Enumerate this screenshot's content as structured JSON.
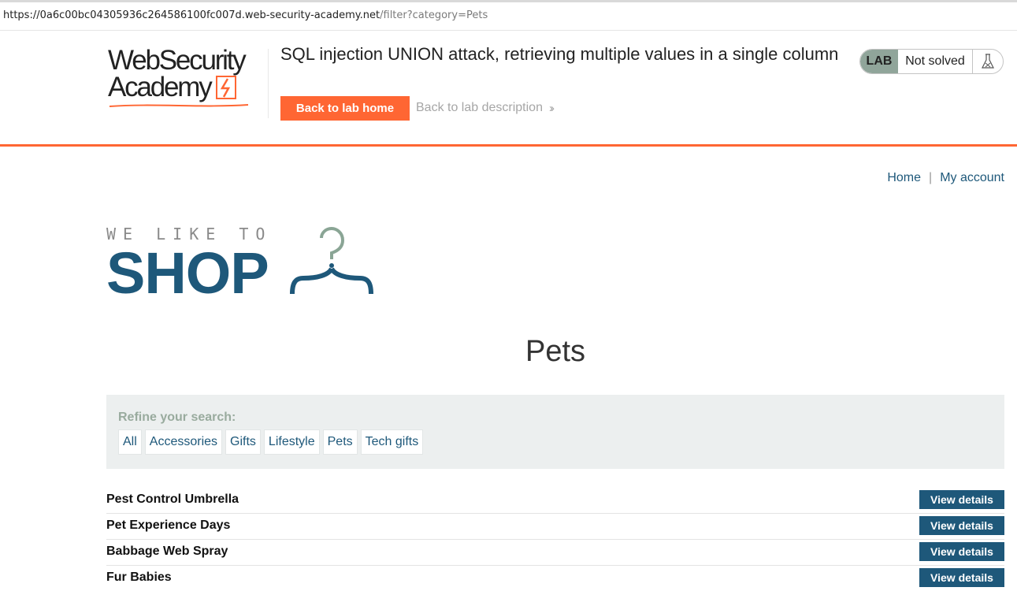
{
  "browser": {
    "url_host": "https://0a6c00bc04305936c264586100fc007d.web-security-academy.net",
    "url_path": "/filter?category=Pets"
  },
  "academy_header": {
    "logo_line1": "WebSecurity",
    "logo_line2": "Academy",
    "lab_title": "SQL injection UNION attack, retrieving multiple values in a single column",
    "back_to_lab_home": "Back to lab home",
    "back_to_lab_description": "Back to lab description",
    "lab_badge": "LAB",
    "lab_status": "Not solved",
    "accent_color": "#ff6633"
  },
  "nav": {
    "home": "Home",
    "separator": "|",
    "my_account": "My account"
  },
  "shop_logo": {
    "tagline": "WE LIKE TO",
    "word": "SHOP"
  },
  "category_heading": "Pets",
  "filters": {
    "label": "Refine your search:",
    "items": [
      "All",
      "Accessories",
      "Gifts",
      "Lifestyle",
      "Pets",
      "Tech gifts"
    ]
  },
  "products": [
    {
      "name": "Pest Control Umbrella",
      "button": "View details"
    },
    {
      "name": "Pet Experience Days",
      "button": "View details"
    },
    {
      "name": "Babbage Web Spray",
      "button": "View details"
    },
    {
      "name": "Fur Babies",
      "button": "View details"
    }
  ],
  "icons": {
    "status": "flask-icon",
    "chevron": "double-chevron-right-icon",
    "logo_mark": "lightning-bolt-icon",
    "shop_mark": "hanger-icon"
  }
}
